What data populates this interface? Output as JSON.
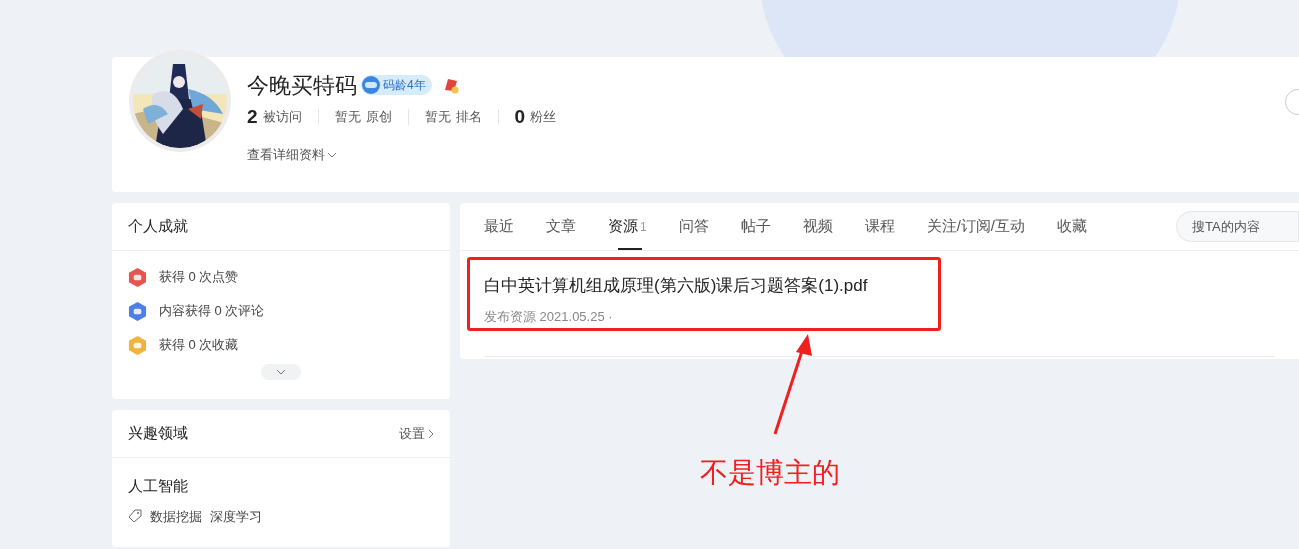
{
  "profile": {
    "name": "今晚买特码",
    "badge": "码龄4年",
    "stats": [
      {
        "kind": "count",
        "value": "2",
        "label": "被访问"
      },
      {
        "kind": "none",
        "value": "暂无",
        "label": "原创"
      },
      {
        "kind": "none",
        "value": "暂无",
        "label": "排名"
      },
      {
        "kind": "count",
        "value": "0",
        "label": "粉丝"
      }
    ],
    "details_link": "查看详细资料"
  },
  "achievements": {
    "title": "个人成就",
    "items": [
      {
        "text": "获得 0 次点赞",
        "color": "#e8554e"
      },
      {
        "text": "内容获得 0 次评论",
        "color": "#4d7fe8"
      },
      {
        "text": "获得 0 次收藏",
        "color": "#f0b43c"
      }
    ]
  },
  "interests": {
    "title": "兴趣领域",
    "settings": "设置",
    "field": "人工智能",
    "tags": [
      "数据挖掘",
      "深度学习"
    ]
  },
  "tabs": [
    {
      "label": "最近",
      "selected": false
    },
    {
      "label": "文章",
      "selected": false
    },
    {
      "label": "资源",
      "count": "1",
      "selected": true
    },
    {
      "label": "问答",
      "selected": false
    },
    {
      "label": "帖子",
      "selected": false
    },
    {
      "label": "视频",
      "selected": false
    },
    {
      "label": "课程",
      "selected": false
    },
    {
      "label": "关注/订阅/互动",
      "selected": false
    },
    {
      "label": "收藏",
      "selected": false
    }
  ],
  "search": {
    "placeholder": "搜TA的内容"
  },
  "resources": [
    {
      "title": "白中英计算机组成原理(第六版)课后习题答案(1).pdf",
      "meta": "发布资源 2021.05.25 ·"
    }
  ],
  "annotation": {
    "text": "不是博主的"
  }
}
